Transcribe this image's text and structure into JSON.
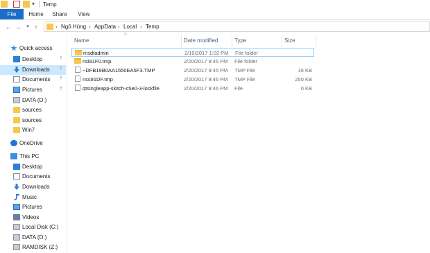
{
  "window": {
    "title": "Temp"
  },
  "ribbon": {
    "tabs": [
      "File",
      "Home",
      "Share",
      "View"
    ]
  },
  "address": {
    "crumbs": [
      "Ngô Hùng",
      "AppData",
      "Local",
      "Temp"
    ]
  },
  "columns": {
    "name": "Name",
    "date": "Date modified",
    "type": "Type",
    "size": "Size"
  },
  "nav": {
    "items": [
      {
        "label": "Quick access",
        "icon": "star-icon"
      },
      {
        "label": "Desktop",
        "icon": "desktop-icon",
        "pinned": true
      },
      {
        "label": "Downloads",
        "icon": "downloads-icon",
        "pinned": true
      },
      {
        "label": "Documents",
        "icon": "documents-icon",
        "pinned": true
      },
      {
        "label": "Pictures",
        "icon": "pictures-icon",
        "pinned": true
      },
      {
        "label": "DATA (D:)",
        "icon": "drive-icon"
      },
      {
        "label": "sources",
        "icon": "folder-icon"
      },
      {
        "label": "sources",
        "icon": "folder-icon"
      },
      {
        "label": "Win7",
        "icon": "folder-icon"
      },
      {
        "label": "OneDrive",
        "icon": "onedrive-icon"
      },
      {
        "label": "This PC",
        "icon": "pc-icon"
      },
      {
        "label": "Desktop",
        "icon": "desktop-icon"
      },
      {
        "label": "Documents",
        "icon": "documents-icon"
      },
      {
        "label": "Downloads",
        "icon": "downloads-icon"
      },
      {
        "label": "Music",
        "icon": "music-icon"
      },
      {
        "label": "Pictures",
        "icon": "pictures-icon"
      },
      {
        "label": "Videos",
        "icon": "videos-icon"
      },
      {
        "label": "Local Disk (C:)",
        "icon": "drive-icon"
      },
      {
        "label": "DATA (D:)",
        "icon": "drive-icon"
      },
      {
        "label": "RAMDISK (Z:)",
        "icon": "drive-icon"
      }
    ]
  },
  "files": [
    {
      "name": "msdtadmin",
      "date": "2/19/2017 1:02 PM",
      "type": "File folder",
      "size": "",
      "kind": "folder"
    },
    {
      "name": "nsi91F0.tmp",
      "date": "2/20/2017 9:46 PM",
      "type": "File folder",
      "size": "",
      "kind": "folder"
    },
    {
      "name": "~DFB19B0AA1650EA5F3.TMP",
      "date": "2/20/2017 9:45 PM",
      "type": "TMP File",
      "size": "16 KB",
      "kind": "file"
    },
    {
      "name": "nss91DF.tmp",
      "date": "2/20/2017 9:46 PM",
      "type": "TMP File",
      "size": "250 KB",
      "kind": "file"
    },
    {
      "name": "qtsingleapp-skitch-c5e0-3-lockfile",
      "date": "2/20/2017 9:46 PM",
      "type": "File",
      "size": "0 KB",
      "kind": "file"
    }
  ],
  "colors": {
    "accent": "#1a6ec7",
    "selection": "#cce8ff",
    "folder": "#f6c84c"
  }
}
